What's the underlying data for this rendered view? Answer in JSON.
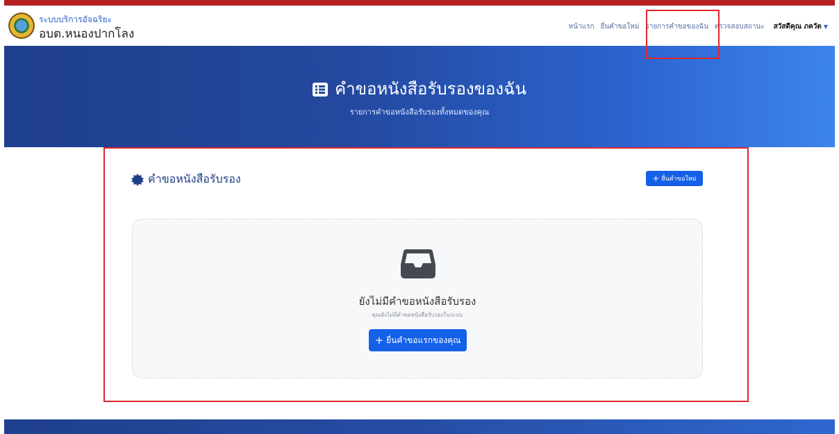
{
  "brand": {
    "top_label": "ระบบบริการอัจฉริยะ",
    "name": "อบต.หนองปากโลง"
  },
  "nav": {
    "items": [
      {
        "label": "หน้าแรก"
      },
      {
        "label": "ยื่นคำขอใหม่"
      },
      {
        "label": "รายการคำขอของฉัน"
      },
      {
        "label": "ตรวจสอบสถานะ"
      }
    ],
    "user_label": "สวัสดีคุณ ภควัต"
  },
  "hero": {
    "title": "คำขอหนังสือรับรองของฉัน",
    "subtitle": "รายการคำขอหนังสือรับรองทั้งหมดของคุณ"
  },
  "section": {
    "title": "คำขอหนังสือรับรอง",
    "new_button_label": "ยื่นคำขอใหม่"
  },
  "empty_state": {
    "title": "ยังไม่มีคำขอหนังสือรับรอง",
    "subtitle": "คุณยังไม่มีคำขอหนังสือรับรองในระบบ",
    "button_label": "ยื่นคำขอแรกของคุณ"
  },
  "icons": {
    "logo": "organization-seal",
    "hero": "list-icon",
    "section": "certificate-badge-icon",
    "empty": "inbox-icon",
    "plus": "plus-icon",
    "caret": "caret-down-icon"
  },
  "colors": {
    "accent_red": "#b41f1f",
    "primary_blue": "#1560e8",
    "hero_dark": "#1f3f8c",
    "hero_light": "#3d84ee",
    "highlight_red": "#e0262b"
  }
}
